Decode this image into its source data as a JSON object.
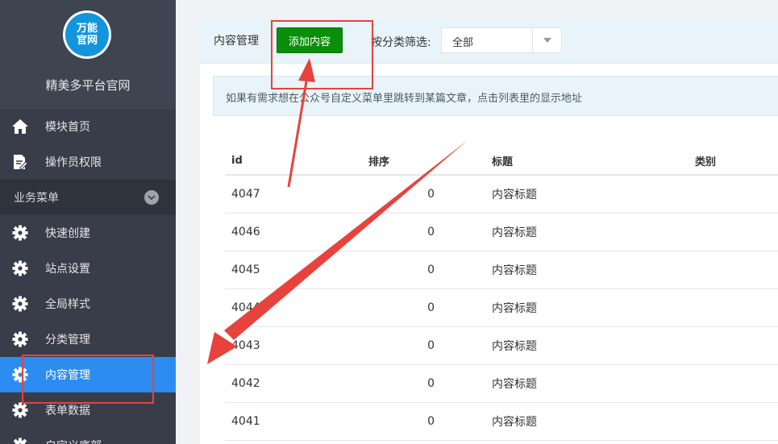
{
  "brand": {
    "logo_line1": "万能",
    "logo_line2": "官网",
    "name": "精美多平台官网"
  },
  "sidebar": {
    "top_items": [
      {
        "label": "模块首页",
        "icon": "home-icon"
      },
      {
        "label": "操作员权限",
        "icon": "document-edit-icon"
      }
    ],
    "group": {
      "label": "业务菜单",
      "icon": "chevron-down-icon"
    },
    "group_items": [
      {
        "label": "快速创建",
        "icon": "gear-icon"
      },
      {
        "label": "站点设置",
        "icon": "gear-icon"
      },
      {
        "label": "全局样式",
        "icon": "gear-icon"
      },
      {
        "label": "分类管理",
        "icon": "gear-icon"
      },
      {
        "label": "内容管理",
        "icon": "gear-icon",
        "active": true
      },
      {
        "label": "表单数据",
        "icon": "gear-icon"
      },
      {
        "label": "自定义底部",
        "icon": "gear-icon"
      }
    ]
  },
  "toolbar": {
    "title": "内容管理",
    "add_label": "添加内容",
    "filter_label": "按分类筛选:",
    "filter_value": "全部"
  },
  "notice": {
    "text": "如果有需求想在公众号自定义菜单里跳转到某篇文章，点击列表里的显示地址"
  },
  "table": {
    "headers": [
      "id",
      "排序",
      "标题",
      "类别"
    ],
    "rows": [
      {
        "id": "4047",
        "sort": "0",
        "title": "内容标题",
        "category": ""
      },
      {
        "id": "4046",
        "sort": "0",
        "title": "内容标题",
        "category": ""
      },
      {
        "id": "4045",
        "sort": "0",
        "title": "内容标题",
        "category": ""
      },
      {
        "id": "4044",
        "sort": "0",
        "title": "内容标题",
        "category": ""
      },
      {
        "id": "4043",
        "sort": "0",
        "title": "内容标题",
        "category": ""
      },
      {
        "id": "4042",
        "sort": "0",
        "title": "内容标题",
        "category": ""
      },
      {
        "id": "4041",
        "sort": "0",
        "title": "内容标题",
        "category": ""
      }
    ]
  },
  "colors": {
    "sidebar_bg": "#393d49",
    "active_bg": "#2d8cf0",
    "add_button": "#0a8f0a",
    "annotation": "#e8423c"
  }
}
